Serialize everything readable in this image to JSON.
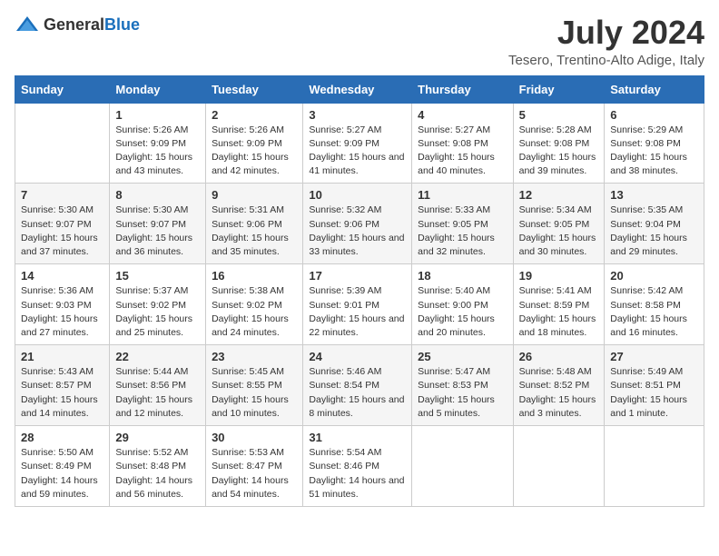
{
  "header": {
    "logo": {
      "general": "General",
      "blue": "Blue"
    },
    "title": "July 2024",
    "subtitle": "Tesero, Trentino-Alto Adige, Italy"
  },
  "days_of_week": [
    "Sunday",
    "Monday",
    "Tuesday",
    "Wednesday",
    "Thursday",
    "Friday",
    "Saturday"
  ],
  "weeks": [
    [
      {
        "day": "",
        "sunrise": "",
        "sunset": "",
        "daylight": ""
      },
      {
        "day": "1",
        "sunrise": "Sunrise: 5:26 AM",
        "sunset": "Sunset: 9:09 PM",
        "daylight": "Daylight: 15 hours and 43 minutes."
      },
      {
        "day": "2",
        "sunrise": "Sunrise: 5:26 AM",
        "sunset": "Sunset: 9:09 PM",
        "daylight": "Daylight: 15 hours and 42 minutes."
      },
      {
        "day": "3",
        "sunrise": "Sunrise: 5:27 AM",
        "sunset": "Sunset: 9:09 PM",
        "daylight": "Daylight: 15 hours and 41 minutes."
      },
      {
        "day": "4",
        "sunrise": "Sunrise: 5:27 AM",
        "sunset": "Sunset: 9:08 PM",
        "daylight": "Daylight: 15 hours and 40 minutes."
      },
      {
        "day": "5",
        "sunrise": "Sunrise: 5:28 AM",
        "sunset": "Sunset: 9:08 PM",
        "daylight": "Daylight: 15 hours and 39 minutes."
      },
      {
        "day": "6",
        "sunrise": "Sunrise: 5:29 AM",
        "sunset": "Sunset: 9:08 PM",
        "daylight": "Daylight: 15 hours and 38 minutes."
      }
    ],
    [
      {
        "day": "7",
        "sunrise": "Sunrise: 5:30 AM",
        "sunset": "Sunset: 9:07 PM",
        "daylight": "Daylight: 15 hours and 37 minutes."
      },
      {
        "day": "8",
        "sunrise": "Sunrise: 5:30 AM",
        "sunset": "Sunset: 9:07 PM",
        "daylight": "Daylight: 15 hours and 36 minutes."
      },
      {
        "day": "9",
        "sunrise": "Sunrise: 5:31 AM",
        "sunset": "Sunset: 9:06 PM",
        "daylight": "Daylight: 15 hours and 35 minutes."
      },
      {
        "day": "10",
        "sunrise": "Sunrise: 5:32 AM",
        "sunset": "Sunset: 9:06 PM",
        "daylight": "Daylight: 15 hours and 33 minutes."
      },
      {
        "day": "11",
        "sunrise": "Sunrise: 5:33 AM",
        "sunset": "Sunset: 9:05 PM",
        "daylight": "Daylight: 15 hours and 32 minutes."
      },
      {
        "day": "12",
        "sunrise": "Sunrise: 5:34 AM",
        "sunset": "Sunset: 9:05 PM",
        "daylight": "Daylight: 15 hours and 30 minutes."
      },
      {
        "day": "13",
        "sunrise": "Sunrise: 5:35 AM",
        "sunset": "Sunset: 9:04 PM",
        "daylight": "Daylight: 15 hours and 29 minutes."
      }
    ],
    [
      {
        "day": "14",
        "sunrise": "Sunrise: 5:36 AM",
        "sunset": "Sunset: 9:03 PM",
        "daylight": "Daylight: 15 hours and 27 minutes."
      },
      {
        "day": "15",
        "sunrise": "Sunrise: 5:37 AM",
        "sunset": "Sunset: 9:02 PM",
        "daylight": "Daylight: 15 hours and 25 minutes."
      },
      {
        "day": "16",
        "sunrise": "Sunrise: 5:38 AM",
        "sunset": "Sunset: 9:02 PM",
        "daylight": "Daylight: 15 hours and 24 minutes."
      },
      {
        "day": "17",
        "sunrise": "Sunrise: 5:39 AM",
        "sunset": "Sunset: 9:01 PM",
        "daylight": "Daylight: 15 hours and 22 minutes."
      },
      {
        "day": "18",
        "sunrise": "Sunrise: 5:40 AM",
        "sunset": "Sunset: 9:00 PM",
        "daylight": "Daylight: 15 hours and 20 minutes."
      },
      {
        "day": "19",
        "sunrise": "Sunrise: 5:41 AM",
        "sunset": "Sunset: 8:59 PM",
        "daylight": "Daylight: 15 hours and 18 minutes."
      },
      {
        "day": "20",
        "sunrise": "Sunrise: 5:42 AM",
        "sunset": "Sunset: 8:58 PM",
        "daylight": "Daylight: 15 hours and 16 minutes."
      }
    ],
    [
      {
        "day": "21",
        "sunrise": "Sunrise: 5:43 AM",
        "sunset": "Sunset: 8:57 PM",
        "daylight": "Daylight: 15 hours and 14 minutes."
      },
      {
        "day": "22",
        "sunrise": "Sunrise: 5:44 AM",
        "sunset": "Sunset: 8:56 PM",
        "daylight": "Daylight: 15 hours and 12 minutes."
      },
      {
        "day": "23",
        "sunrise": "Sunrise: 5:45 AM",
        "sunset": "Sunset: 8:55 PM",
        "daylight": "Daylight: 15 hours and 10 minutes."
      },
      {
        "day": "24",
        "sunrise": "Sunrise: 5:46 AM",
        "sunset": "Sunset: 8:54 PM",
        "daylight": "Daylight: 15 hours and 8 minutes."
      },
      {
        "day": "25",
        "sunrise": "Sunrise: 5:47 AM",
        "sunset": "Sunset: 8:53 PM",
        "daylight": "Daylight: 15 hours and 5 minutes."
      },
      {
        "day": "26",
        "sunrise": "Sunrise: 5:48 AM",
        "sunset": "Sunset: 8:52 PM",
        "daylight": "Daylight: 15 hours and 3 minutes."
      },
      {
        "day": "27",
        "sunrise": "Sunrise: 5:49 AM",
        "sunset": "Sunset: 8:51 PM",
        "daylight": "Daylight: 15 hours and 1 minute."
      }
    ],
    [
      {
        "day": "28",
        "sunrise": "Sunrise: 5:50 AM",
        "sunset": "Sunset: 8:49 PM",
        "daylight": "Daylight: 14 hours and 59 minutes."
      },
      {
        "day": "29",
        "sunrise": "Sunrise: 5:52 AM",
        "sunset": "Sunset: 8:48 PM",
        "daylight": "Daylight: 14 hours and 56 minutes."
      },
      {
        "day": "30",
        "sunrise": "Sunrise: 5:53 AM",
        "sunset": "Sunset: 8:47 PM",
        "daylight": "Daylight: 14 hours and 54 minutes."
      },
      {
        "day": "31",
        "sunrise": "Sunrise: 5:54 AM",
        "sunset": "Sunset: 8:46 PM",
        "daylight": "Daylight: 14 hours and 51 minutes."
      },
      {
        "day": "",
        "sunrise": "",
        "sunset": "",
        "daylight": ""
      },
      {
        "day": "",
        "sunrise": "",
        "sunset": "",
        "daylight": ""
      },
      {
        "day": "",
        "sunrise": "",
        "sunset": "",
        "daylight": ""
      }
    ]
  ]
}
